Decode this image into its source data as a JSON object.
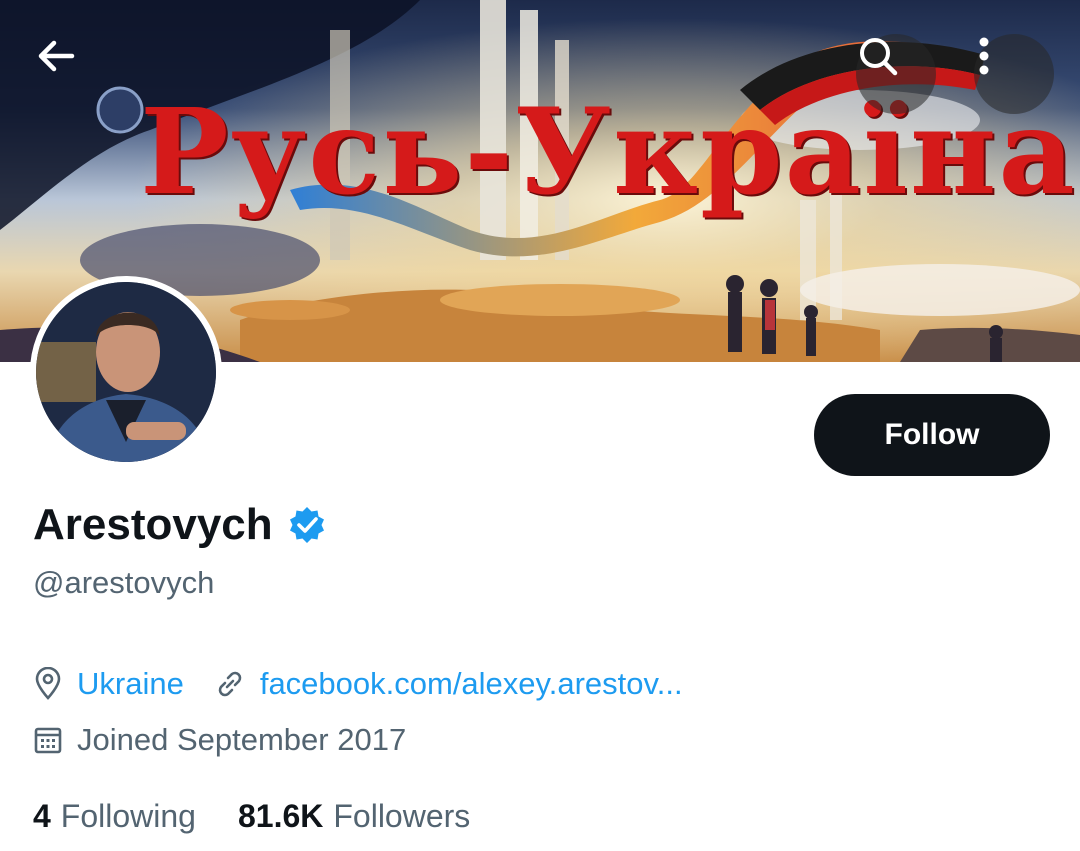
{
  "banner": {
    "title": "Русь-Україна"
  },
  "profile": {
    "display_name": "Arestovych",
    "handle": "@arestovych",
    "location": "Ukraine",
    "website": "facebook.com/alexey.arestov...",
    "joined": "Joined September 2017",
    "following_count": "4",
    "following_label": "Following",
    "followers_count": "81.6K",
    "followers_label": "Followers"
  },
  "actions": {
    "follow_label": "Follow"
  },
  "icons": {
    "back": "arrow-left-icon",
    "search": "search-icon",
    "more": "more-vertical-icon",
    "verified": "verified-badge-icon",
    "location": "location-pin-icon",
    "link": "link-icon",
    "calendar": "calendar-icon"
  },
  "colors": {
    "accent": "#1d9bf0",
    "follow_button": "#0f1419",
    "secondary_text": "#536471",
    "banner_title": "#d51a1a"
  }
}
